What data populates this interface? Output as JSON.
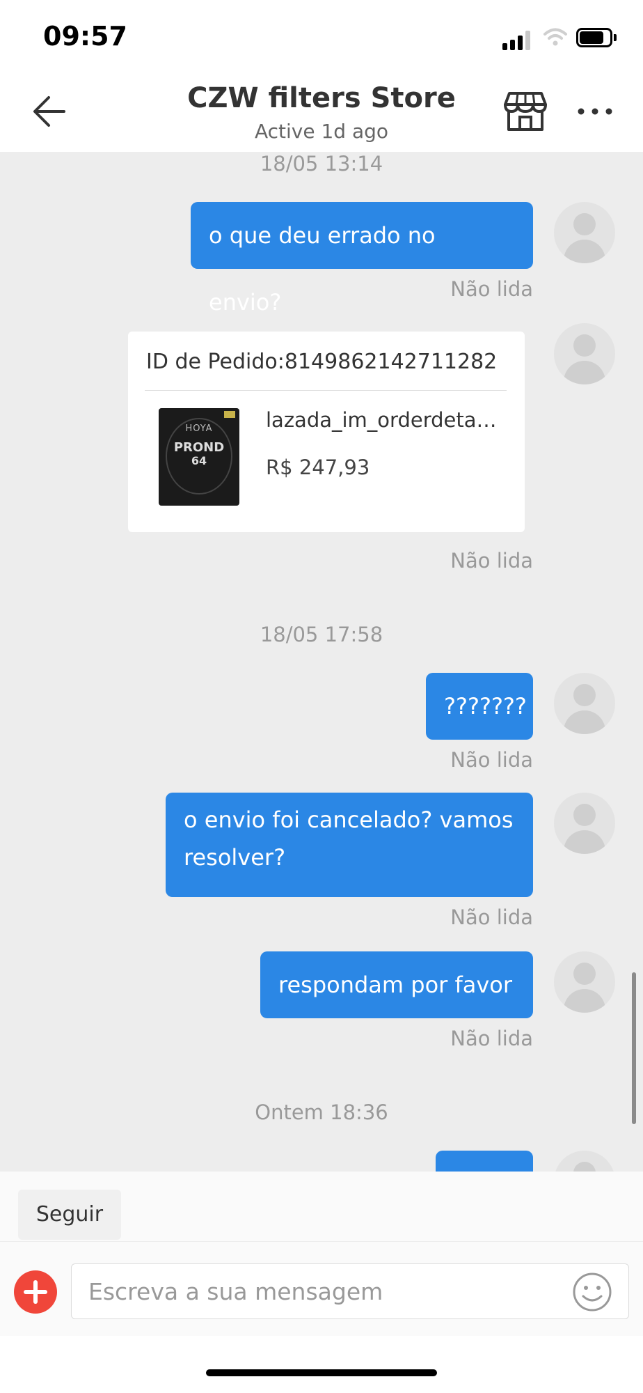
{
  "status_bar": {
    "time": "09:57"
  },
  "header": {
    "title": "CZW filters Store",
    "subtitle": "Active 1d ago",
    "icons": {
      "back": "back-arrow-icon",
      "store": "store-icon",
      "more": "more-icon"
    }
  },
  "chat": {
    "timestamps": [
      "18/05 13:14",
      "18/05 17:58",
      "Ontem 18:36"
    ],
    "messages": [
      {
        "text": "o que deu errado no envio?",
        "status": "Não lida"
      },
      {
        "text": "???????",
        "status": "Não lida"
      },
      {
        "text": "o envio foi cancelado? vamos resolver?",
        "status": "Não lida"
      },
      {
        "text": "respondam por favor",
        "status": "Não lida"
      }
    ],
    "order_card": {
      "order_id": "ID de Pedido:8149862142711282",
      "product_name": "lazada_im_orderdetail_...",
      "price": "R$ 247,93",
      "status": "Não lida",
      "image_text": {
        "brand": "HOYA",
        "line1": "PROND",
        "line2": "64"
      }
    }
  },
  "bottom": {
    "follow_label": "Seguir",
    "input_placeholder": "Escreva a sua mensagem"
  },
  "colors": {
    "bubble": "#2b87e5",
    "chat_bg": "#ededed",
    "plus": "#f0463a"
  }
}
